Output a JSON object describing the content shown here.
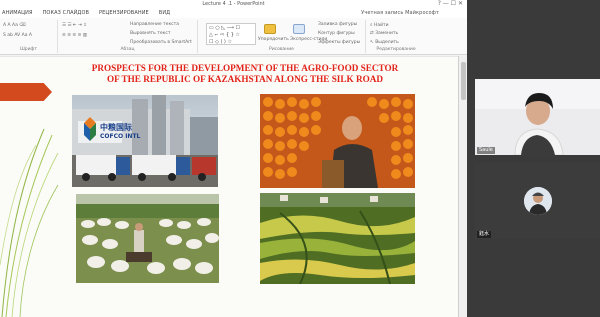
{
  "window": {
    "title": "Lecture 4 .1 - PowerPoint",
    "controls": "?  —  ☐  ✕"
  },
  "tabs": [
    "АНИМАЦИЯ",
    "ПОКАЗ СЛАЙДОВ",
    "РЕЦЕНЗИРОВАНИЕ",
    "ВИД"
  ],
  "account": "Учетная запись Майкрософт",
  "ribbon": {
    "groups": {
      "font": "Шрифт",
      "paragraph": "Абзац",
      "drawing": "Рисование",
      "editing": "Редактирование"
    },
    "paragraph_cmds": [
      "Направление текста",
      "Выровнять текст",
      "Преобразовать в SmartArt"
    ],
    "drawing_cmds": [
      "Заливка фигуры",
      "Контур фигуры",
      "Эффекты фигуры"
    ],
    "arrange_label": "Упорядочить",
    "styles_label": "Экспресс-стили",
    "editing_cmds": [
      "Найти",
      "Заменить",
      "Выделить"
    ]
  },
  "slide": {
    "title_line1": "PROSPECTS FOR THE DEVELOPMENT OF THE AGRO-FOOD SECTOR",
    "title_line2": "OF THE REPUBLIC OF KAZAKHSTAN ALONG THE SILK ROAD",
    "photo1_logo_cn": "中粮国际",
    "photo1_logo_en": "COFCO INTL"
  },
  "video": {
    "participant1": "Saule",
    "participant2": "鈺水"
  },
  "colors": {
    "title_red": "#e2231a",
    "arrow": "#d44a1f",
    "accent": "#b7472a"
  }
}
